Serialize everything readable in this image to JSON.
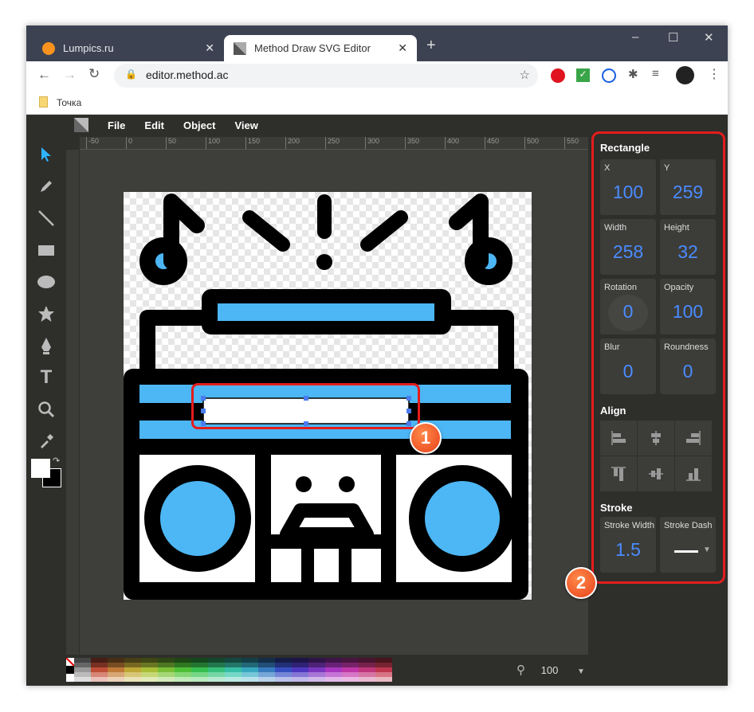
{
  "browser": {
    "tabs": [
      {
        "label": "Lumpics.ru"
      },
      {
        "label": "Method Draw SVG Editor"
      }
    ],
    "url": "editor.method.ac",
    "bookmark": "Точка"
  },
  "menu": [
    "File",
    "Edit",
    "Object",
    "View"
  ],
  "ruler_top": [
    "-50",
    "0",
    "50",
    "100",
    "150",
    "200",
    "250",
    "300",
    "350",
    "400",
    "450",
    "500",
    "550"
  ],
  "panel": {
    "title": "Rectangle",
    "fields": [
      {
        "label": "X",
        "value": "100"
      },
      {
        "label": "Y",
        "value": "259"
      },
      {
        "label": "Width",
        "value": "258"
      },
      {
        "label": "Height",
        "value": "32"
      },
      {
        "label": "Rotation",
        "value": "0"
      },
      {
        "label": "Opacity",
        "value": "100"
      },
      {
        "label": "Blur",
        "value": "0"
      },
      {
        "label": "Roundness",
        "value": "0"
      }
    ],
    "align_title": "Align",
    "stroke_title": "Stroke",
    "stroke": [
      {
        "label": "Stroke Width",
        "value": "1.5"
      },
      {
        "label": "Stroke Dash"
      }
    ]
  },
  "zoom": {
    "value": "100"
  },
  "annotations": [
    "1",
    "2"
  ],
  "colors": {
    "accent": "#4a8cff",
    "artwork_blue": "#4db6f5",
    "highlight": "#e41c1c"
  }
}
